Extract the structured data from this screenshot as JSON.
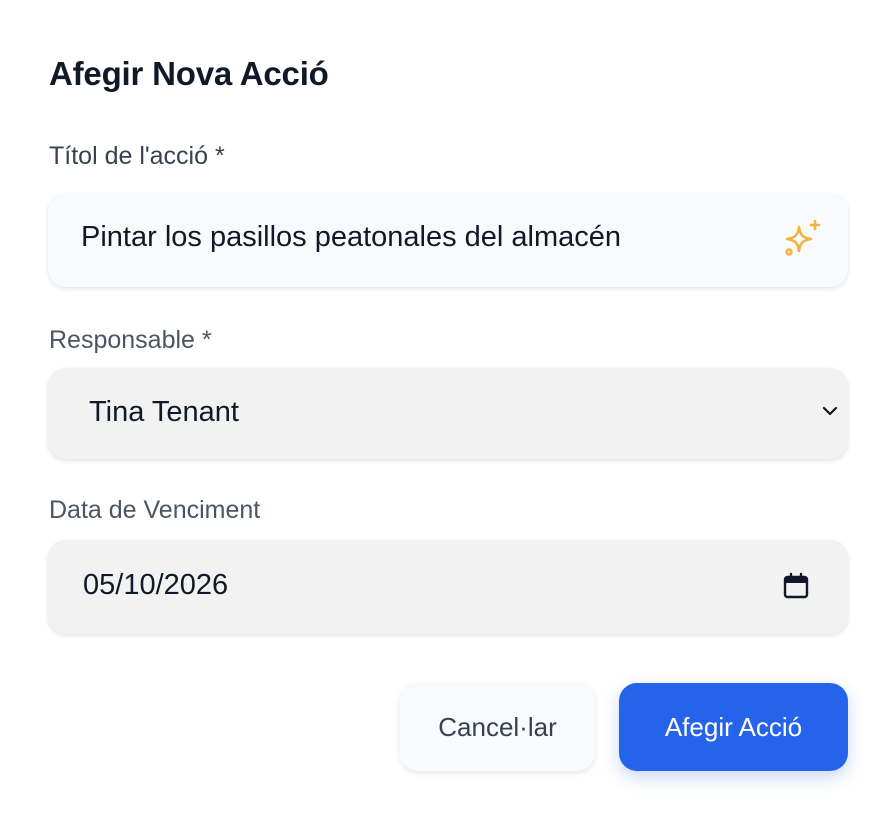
{
  "dialog": {
    "title": "Afegir Nova Acció"
  },
  "fields": {
    "action_title": {
      "label": "Títol de l'acció *",
      "value": "Pintar los pasillos peatonales del almacén",
      "icon": "sparkles-icon"
    },
    "responsible": {
      "label": "Responsable *",
      "selected": "Tina Tenant",
      "icon": "chevron-down-icon"
    },
    "due_date": {
      "label": "Data de Venciment",
      "value": "05/10/2026",
      "icon": "calendar-icon"
    }
  },
  "buttons": {
    "cancel": "Cancel·lar",
    "submit": "Afegir Acció"
  },
  "colors": {
    "primary": "#2563eb",
    "sparkle": "#f2b441",
    "text": "#111827",
    "label": "#4b5563"
  }
}
